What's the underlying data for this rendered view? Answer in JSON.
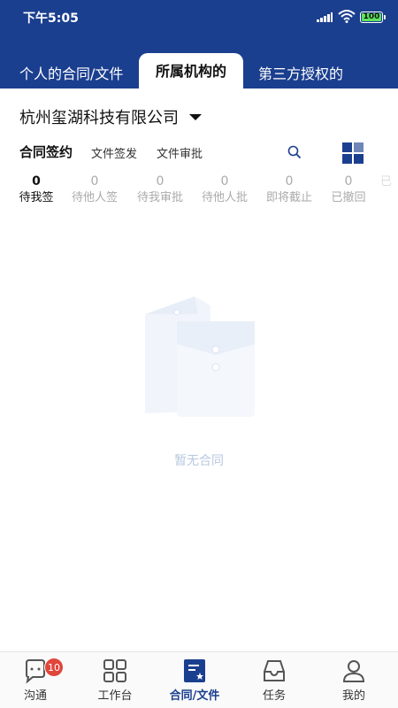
{
  "status_bar": {
    "time": "下午5:05",
    "battery": "100"
  },
  "top_tabs": [
    {
      "label": "个人的合同/文件"
    },
    {
      "label": "所属机构的"
    },
    {
      "label": "第三方授权的"
    }
  ],
  "org": {
    "name": "杭州玺湖科技有限公司"
  },
  "sub_tabs": [
    {
      "label": "合同签约"
    },
    {
      "label": "文件签发"
    },
    {
      "label": "文件审批"
    }
  ],
  "counters": [
    {
      "count": "0",
      "label": "待我签"
    },
    {
      "count": "0",
      "label": "待他人签"
    },
    {
      "count": "0",
      "label": "待我审批"
    },
    {
      "count": "0",
      "label": "待他人批"
    },
    {
      "count": "0",
      "label": "即将截止"
    },
    {
      "count": "0",
      "label": "已撤回"
    },
    {
      "count": "",
      "label": "已"
    }
  ],
  "empty_state": {
    "text": "暂无合同"
  },
  "tab_bar": {
    "items": [
      {
        "label": "沟通",
        "icon": "chat-icon",
        "badge": "10"
      },
      {
        "label": "工作台",
        "icon": "grid-apps-icon"
      },
      {
        "label": "合同/文件",
        "icon": "contract-file-icon"
      },
      {
        "label": "任务",
        "icon": "inbox-tray-icon"
      },
      {
        "label": "我的",
        "icon": "person-icon"
      }
    ]
  },
  "colors": {
    "primary": "#1b3f8f",
    "badge": "#e0463c",
    "muted": "#aaaaaa",
    "empty_text": "#b7c8df"
  }
}
